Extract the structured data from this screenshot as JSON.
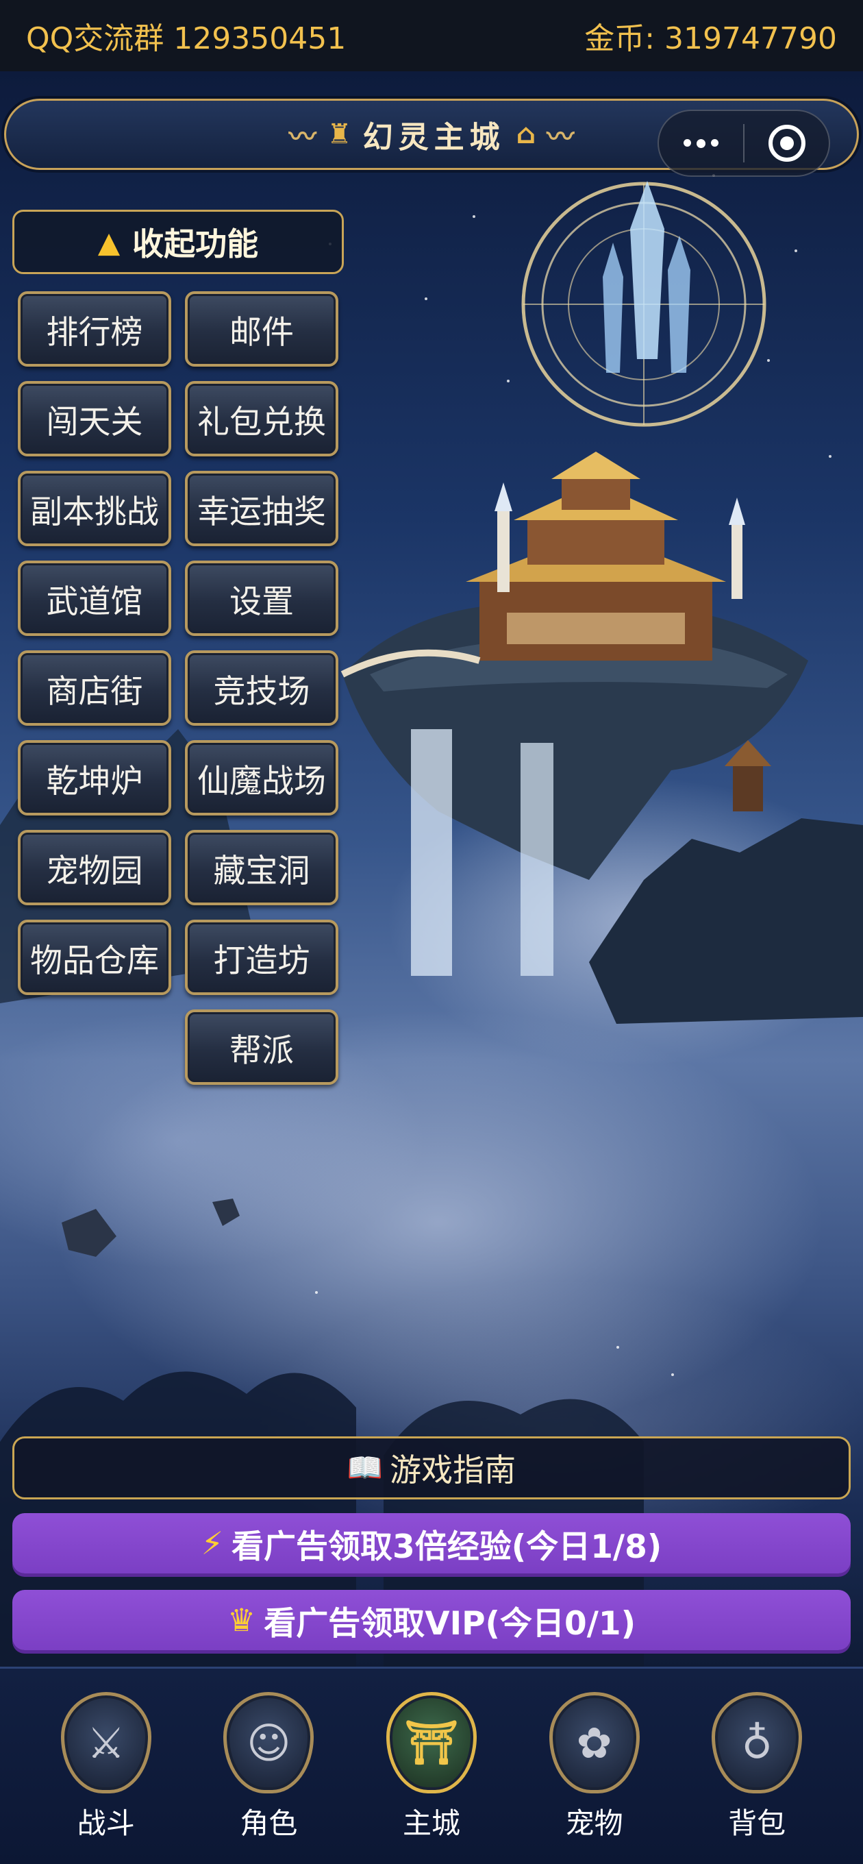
{
  "topbar": {
    "group_label": "QQ交流群 129350451",
    "coins_label": "金币: 319747790"
  },
  "banner": {
    "title": "幻灵主城",
    "title_icon": "castle-icon",
    "more_icon": "more-dots-icon",
    "close_icon": "target-close-icon"
  },
  "collapse": {
    "icon": "warning-triangle-icon",
    "label": "收起功能"
  },
  "functions": [
    "排行榜",
    "邮件",
    "闯天关",
    "礼包兑换",
    "副本挑战",
    "幸运抽奖",
    "武道馆",
    "设置",
    "商店街",
    "竞技场",
    "乾坤炉",
    "仙魔战场",
    "宠物园",
    "藏宝洞",
    "物品仓库",
    "打造坊",
    "帮派"
  ],
  "actions": {
    "guide": {
      "icon": "book-icon",
      "label": "游戏指南"
    },
    "exp_ad": {
      "icon": "lightning-icon",
      "label": "看广告领取3倍经验(今日1/8)"
    },
    "vip_ad": {
      "icon": "crown-icon",
      "label": "看广告领取VIP(今日0/1)"
    }
  },
  "nav": [
    {
      "label": "战斗",
      "icon": "crossed-swords-icon",
      "active": false
    },
    {
      "label": "角色",
      "icon": "character-icon",
      "active": false
    },
    {
      "label": "主城",
      "icon": "palace-icon",
      "active": true
    },
    {
      "label": "宠物",
      "icon": "paw-icon",
      "active": false
    },
    {
      "label": "背包",
      "icon": "bag-icon",
      "active": false
    }
  ],
  "colors": {
    "gold": "#f2c14e",
    "purple": "#8a4bd2",
    "border_gold": "#c9a557"
  }
}
